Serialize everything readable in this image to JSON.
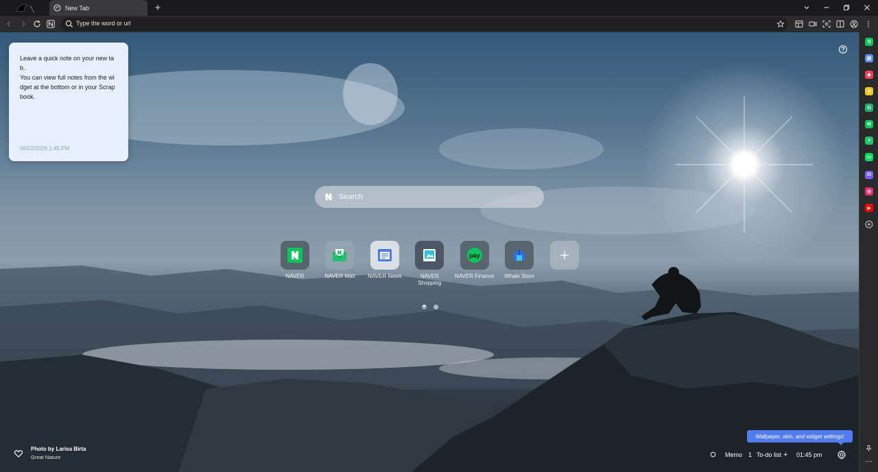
{
  "tab": {
    "title": "New Tab",
    "new_tab_symbol": "+"
  },
  "toolbar": {
    "address_placeholder": "Type the word or url"
  },
  "memo": {
    "text": "Leave a quick note on your new tab.\nYou can view full notes from the widget at the bottom or in your Scrapbook.",
    "date": "06/02/2026 1:45 PM"
  },
  "search": {
    "placeholder": "Search"
  },
  "shortcuts": [
    {
      "label": "NAVER",
      "icon": "naver-icon"
    },
    {
      "label": "NAVER Mail",
      "icon": "naver-mail-icon"
    },
    {
      "label": "NAVER News",
      "icon": "naver-news-icon"
    },
    {
      "label": "NAVER Shopping",
      "icon": "naver-shopping-icon"
    },
    {
      "label": "NAVER Finance",
      "icon": "naver-pay-icon"
    },
    {
      "label": "Whale Store",
      "icon": "whale-store-icon"
    },
    {
      "label": "",
      "icon": "add-shortcut-icon"
    }
  ],
  "photo": {
    "author": "Photo by Larisa Birta",
    "collection": "Great Nature"
  },
  "tooltip": {
    "text": "Wallpaper, skin, and widget settings!"
  },
  "bottom": {
    "memo_label": "Memo",
    "memo_count": "1",
    "todo_label": "To-do list",
    "todo_add": "+",
    "time": "01:45 pm"
  },
  "sidebar_apps": [
    {
      "name": "naver-app",
      "color": "#03c75a",
      "glyph": "N"
    },
    {
      "name": "calculator-app",
      "color": "#5d8df0",
      "glyph": "▤"
    },
    {
      "name": "pocket-app",
      "color": "#ef4056",
      "glyph": "◆"
    },
    {
      "name": "favorites-app",
      "color": "#f5c518",
      "glyph": "★"
    },
    {
      "name": "translate-app",
      "color": "#1fb16b",
      "glyph": "G"
    },
    {
      "name": "mail-app",
      "color": "#03c75a",
      "glyph": "✉"
    },
    {
      "name": "news-app",
      "color": "#1ec46e",
      "glyph": "≡"
    },
    {
      "name": "webtoon-app",
      "color": "#00dc64",
      "glyph": "▭"
    },
    {
      "name": "calendar-app",
      "color": "#7a5cf0",
      "glyph": "31"
    },
    {
      "name": "instagram-app",
      "color": "#e1306c",
      "glyph": "◎"
    },
    {
      "name": "youtube-app",
      "color": "#ff0000",
      "glyph": "▶"
    }
  ],
  "colors": {
    "accent": "#4f7cf2",
    "memo_bg": "#e6f0fc",
    "naver_green": "#03c75a"
  }
}
